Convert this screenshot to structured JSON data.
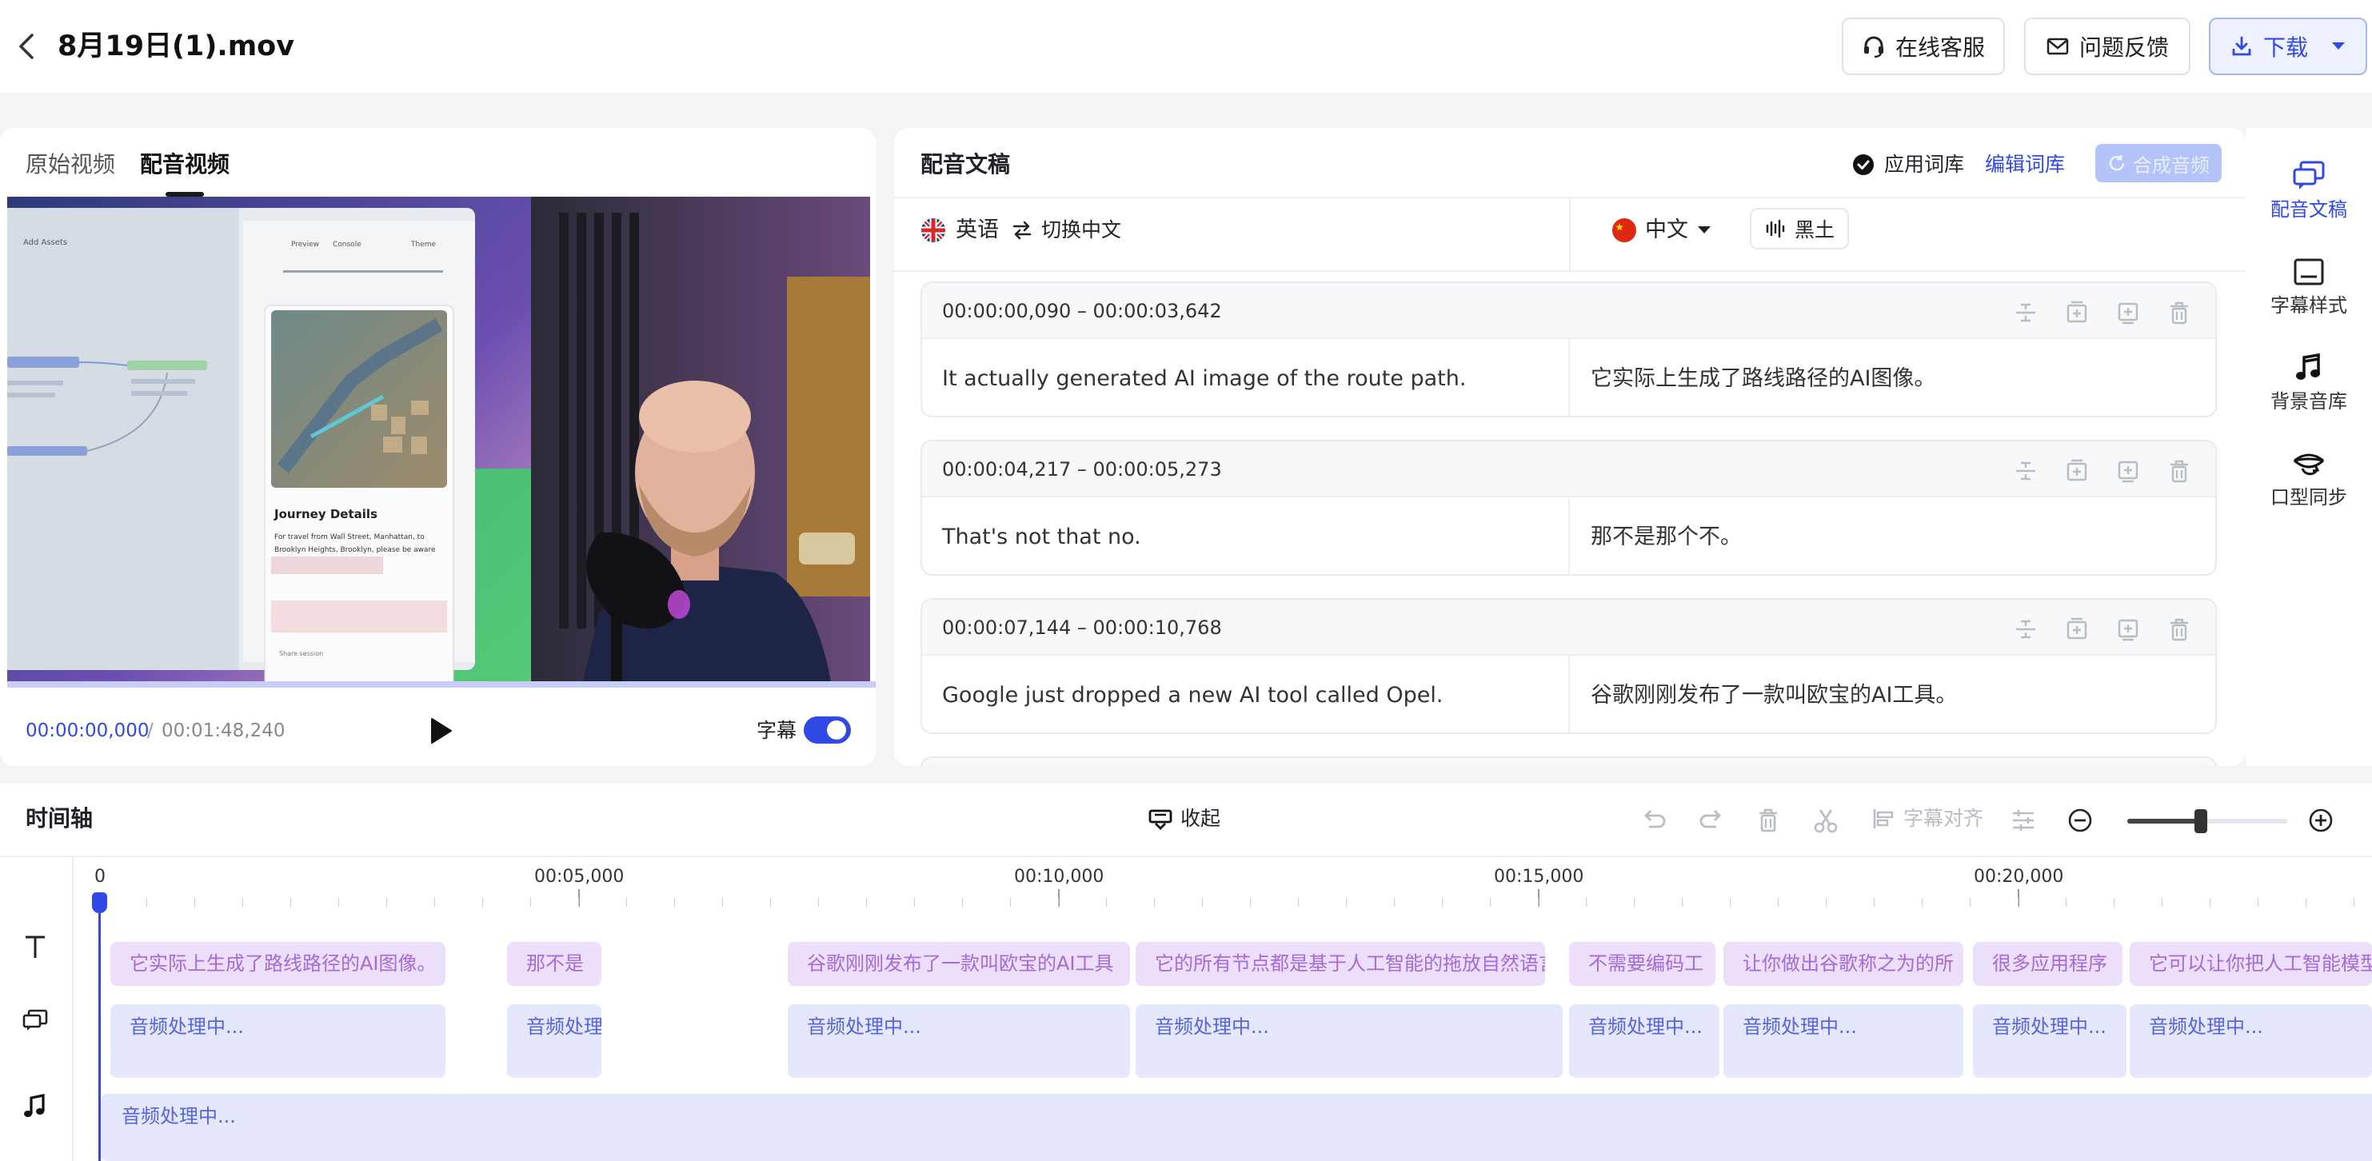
{
  "header": {
    "file_title": "8月19日(1).mov",
    "support_label": "在线客服",
    "feedback_label": "问题反馈",
    "download_label": "下载"
  },
  "video": {
    "tabs": [
      {
        "label": "原始视频",
        "active": false
      },
      {
        "label": "配音视频",
        "active": true
      }
    ],
    "current_time": "00:00:00,000",
    "separator": "/",
    "total_time": "00:01:48,240",
    "subtitle_label": "字幕",
    "subtitle_enabled": true,
    "frame_texts": {
      "tab_preview": "Preview",
      "tab_console": "Console",
      "tab_theme": "Theme",
      "add_assets": "Add Assets",
      "card_title": "Journey Details",
      "card_line1": "For travel from Wall Street, Manhattan, to",
      "card_line2": "Brooklyn Heights, Brooklyn, please be aware",
      "share": "Share session"
    }
  },
  "script": {
    "title": "配音文稿",
    "apply_lexicon_label": "应用词库",
    "apply_lexicon_checked": true,
    "edit_lexicon_label": "编辑词库",
    "synthesize_label": "合成音频",
    "source_language": "英语",
    "switch_label": "切换中文",
    "target_language": "中文",
    "voice_name": "黑土",
    "segments": [
      {
        "time": "00:00:00,090 – 00:00:03,642",
        "source": "It actually generated AI image of the route path.",
        "target": "它实际上生成了路线路径的AI图像。"
      },
      {
        "time": "00:00:04,217 – 00:00:05,273",
        "source": "That's not that no.",
        "target": "那不是那个不。"
      },
      {
        "time": "00:00:07,144 – 00:00:10,768",
        "source": "Google just dropped a new AI tool called Opel.",
        "target": "谷歌刚刚发布了一款叫欧宝的AI工具。"
      }
    ]
  },
  "rail": {
    "items": [
      {
        "label": "配音文稿",
        "icon": "script-icon",
        "active": true
      },
      {
        "label": "字幕样式",
        "icon": "subtitle-style-icon",
        "active": false
      },
      {
        "label": "背景音库",
        "icon": "music-icon",
        "active": false
      },
      {
        "label": "口型同步",
        "icon": "lip-sync-icon",
        "active": false
      }
    ]
  },
  "timeline": {
    "title": "时间轴",
    "collapse_label": "收起",
    "align_label": "字幕对齐",
    "ruler_labels": [
      "0",
      "00:05,000",
      "00:10,000",
      "00:15,000",
      "00:20,000"
    ],
    "subtitle_clips": [
      "它实际上生成了路线路径的AI图像。",
      "那不是",
      "谷歌刚刚发布了一款叫欧宝的AI工具",
      "它的所有节点都是基于人工智能的拖放自然语言",
      "不需要编码工",
      "让你做出谷歌称之为的所",
      "很多应用程序",
      "它可以让你把人工智能模型"
    ],
    "audio_clip_label": "音频处理中...",
    "audio_clips": [
      "音频处理中...",
      "音频处理",
      "音频处理中...",
      "音频处理中...",
      "音频处理中...",
      "音频处理中...",
      "音频处理中...",
      "音频处理中..."
    ],
    "bgm_label": "音频处理中...",
    "zoom_level": 0.46
  },
  "colors": {
    "accent": "#3048e5",
    "subtitle_clip_bg": "#ecdffb",
    "audio_clip_bg": "#e5e8fd"
  }
}
